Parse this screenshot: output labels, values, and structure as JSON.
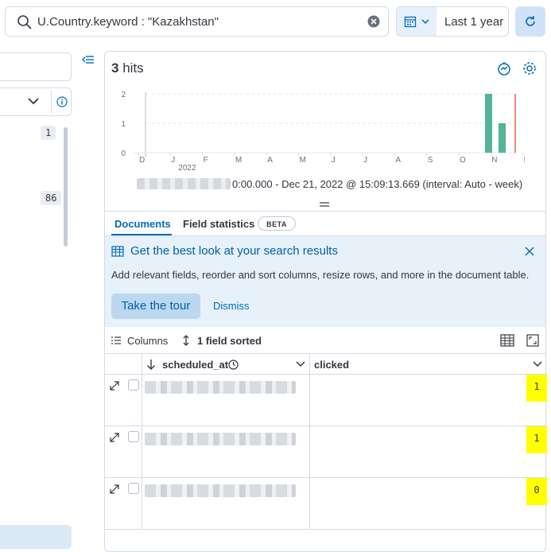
{
  "query": {
    "text": "U.Country.keyword : \"Kazakhstan\""
  },
  "date_picker": {
    "label": "Last 1 year"
  },
  "sidebar": {
    "counts": [
      "1",
      "86"
    ]
  },
  "hits": {
    "count": "3",
    "label": "hits"
  },
  "chart_data": {
    "type": "bar",
    "x_ticks": [
      "D",
      "J",
      "F",
      "M",
      "A",
      "M",
      "J",
      "J",
      "A",
      "S",
      "O",
      "N",
      "D"
    ],
    "x_sublabel": "2022",
    "y_ticks": [
      "0",
      "1",
      "2"
    ],
    "ylim": [
      0,
      2
    ],
    "bars": [
      {
        "x": "Dec (week 1)",
        "value": 2
      },
      {
        "x": "Dec (week 2)",
        "value": 1
      }
    ],
    "bar_color": "#54b399",
    "now_marker_color": "#e7664c",
    "grid": true
  },
  "time_range": {
    "text": "0:00.000 - Dec 21, 2022 @ 15:09:13.669 (interval: Auto - week)"
  },
  "tabs": {
    "documents": "Documents",
    "field_statistics": "Field statistics",
    "beta": "BETA"
  },
  "callout": {
    "title": "Get the best look at your search results",
    "body": "Add relevant fields, reorder and sort columns, resize rows, and more in the document table.",
    "tour_button": "Take the tour",
    "dismiss": "Dismiss"
  },
  "grid_toolbar": {
    "columns": "Columns",
    "sorted": "1 field sorted"
  },
  "grid": {
    "columns": [
      "scheduled_at",
      "clicked"
    ],
    "rows": [
      {
        "clicked": "1"
      },
      {
        "clicked": "1"
      },
      {
        "clicked": "0"
      }
    ]
  },
  "colors": {
    "accent": "#006bb8",
    "highlight": "#ffff00"
  }
}
